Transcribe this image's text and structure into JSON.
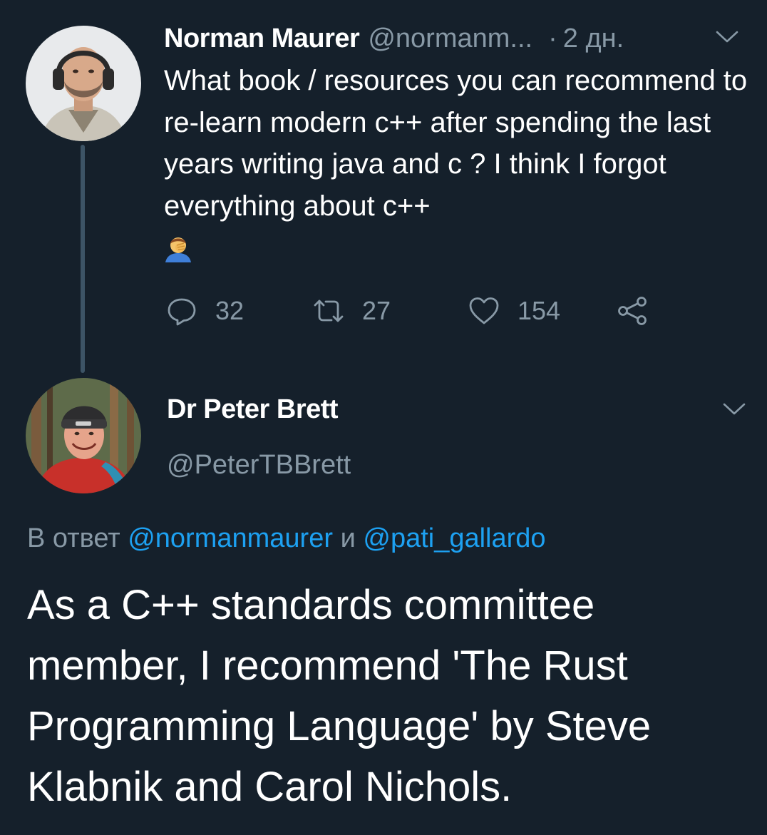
{
  "tweet1": {
    "author_name": "Norman Maurer",
    "handle": "@normanm...",
    "dot": "·",
    "time": "2 дн.",
    "text": "What book / resources you can recommend to re-learn modern c++ after spending the last years writing java and c ? I think I forgot everything about c++",
    "emoji": "face-palm-emoji",
    "stats": {
      "replies": "32",
      "retweets": "27",
      "likes": "154"
    }
  },
  "tweet2": {
    "author_name": "Dr Peter Brett",
    "handle": "@PeterTBBrett",
    "reply_prefix": "В ответ",
    "mention1": "@normanmaurer",
    "conjunction": "и",
    "mention2": "@pati_gallardo",
    "text": "As a C++ standards committee member, I recommend 'The Rust Programming Language' by Steve Klabnik and Carol Nichols."
  },
  "colors": {
    "background": "#15202b",
    "text_primary": "#ffffff",
    "text_secondary": "#8899a6",
    "link": "#1da1f2",
    "thread_line": "#3d5466"
  },
  "icons": [
    "reply-icon",
    "retweet-icon",
    "like-icon",
    "share-icon",
    "chevron-down-icon"
  ]
}
